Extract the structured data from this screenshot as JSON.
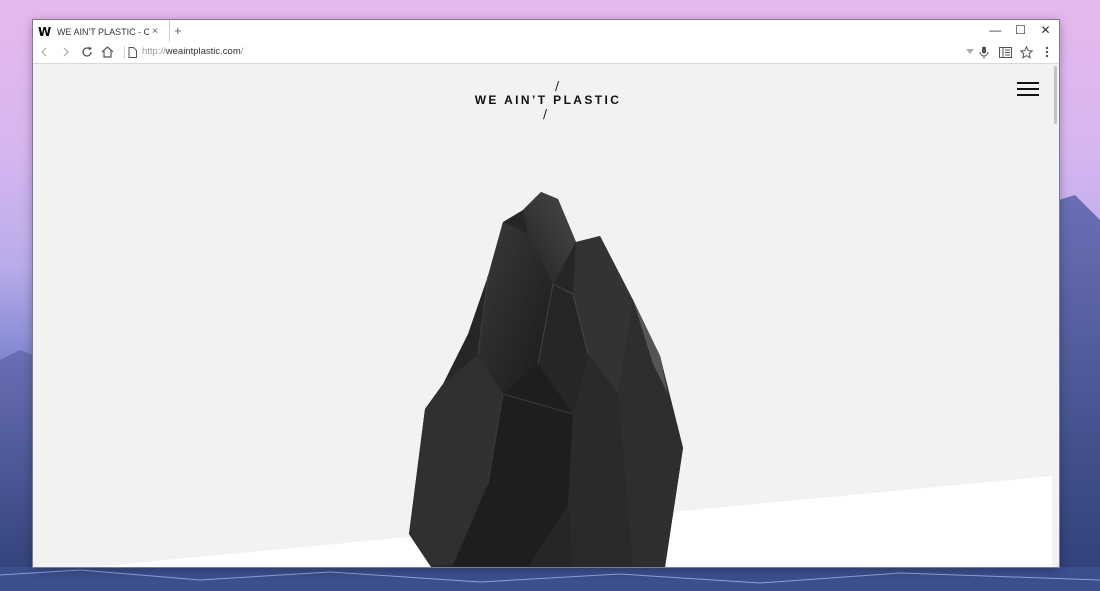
{
  "browser": {
    "tab_favicon": "W",
    "tab_title": "WE AIN'T PLASTIC - Crea...",
    "tab_close": "×",
    "new_tab": "+",
    "url_proto": "http://",
    "url_host": "weaintplastic.com",
    "url_path": "/",
    "minimize": "—",
    "maximize": "☐",
    "close": "✕"
  },
  "site": {
    "slash_top": "/",
    "logo": "WE AIN’T PLASTIC",
    "slash_bottom": "/"
  },
  "icons": [
    "back-icon",
    "forward-icon",
    "reload-icon",
    "home-icon",
    "page-icon",
    "dropdown-icon",
    "mic-icon",
    "reader-icon",
    "star-icon",
    "menu-icon",
    "hamburger-icon"
  ],
  "colors": {
    "page_bg": "#f2f2f2",
    "rock": "#2a2a2a",
    "ground": "#ffffff"
  }
}
